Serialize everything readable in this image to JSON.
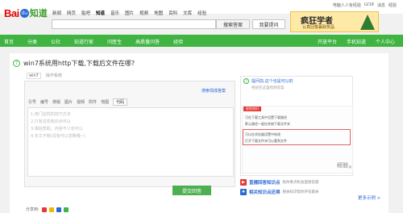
{
  "topbar": {
    "user": "电脑人人有经验",
    "level": "LV18",
    "items": [
      "消息",
      "经验"
    ]
  },
  "logo": {
    "bai": "Bai",
    "paw": "du",
    "zd": "知道"
  },
  "mainnav": [
    "新闻",
    "网页",
    "贴吧",
    "知道",
    "音乐",
    "图片",
    "视频",
    "地图",
    "百科",
    "文库",
    "经验"
  ],
  "search": {
    "button": "搜索答案",
    "ask": "我要提问"
  },
  "promo": {
    "title": "疯狂学者",
    "subtitle": "认真回答赢取奖品"
  },
  "greenbar": {
    "items": [
      "首页",
      "分类",
      "公社",
      "知道行家",
      "问医生",
      "高质量问答",
      "经验"
    ],
    "right": [
      "开放平台",
      "手机知道",
      "个人中心"
    ]
  },
  "question": {
    "title": "win7系统用http下载,下载后文件在哪?",
    "tag": "win7",
    "meta": "操作系统"
  },
  "editor": {
    "search_link": "搜索现成答案",
    "tools": [
      "引号",
      "编号",
      "排版",
      "图片",
      "视频",
      "附件",
      "地图"
    ],
    "code": "代码",
    "hints": [
      "1.用门这样的技巧方法",
      "2.只有这些知识点可以",
      "3.相信帮助，内容不少也可以",
      "4.长文不够(没有可以忽略哦~)"
    ],
    "submit": "提交回答"
  },
  "share": {
    "label": "分享到:"
  },
  "rpanel": {
    "title": "提问前,这个也是可以的",
    "sub": "经验在这里找到答案",
    "tag": "经验知识",
    "lines": [
      "可在下载工具中设置下载路径",
      "默认路径一般在系统下载文件夹",
      "可以在浏览器设置中修改",
      "打开下载文件夹可以看到文件"
    ]
  },
  "features": [
    {
      "title": "直播回答知识点",
      "desc": "给你来点机会直接答题",
      "color": "#e53935"
    },
    {
      "title": "相关知识点还得",
      "desc": "相关知识帮你开答题关",
      "color": "#2b67d6"
    }
  ],
  "more": "更多示例 >",
  "watermark": "经验"
}
